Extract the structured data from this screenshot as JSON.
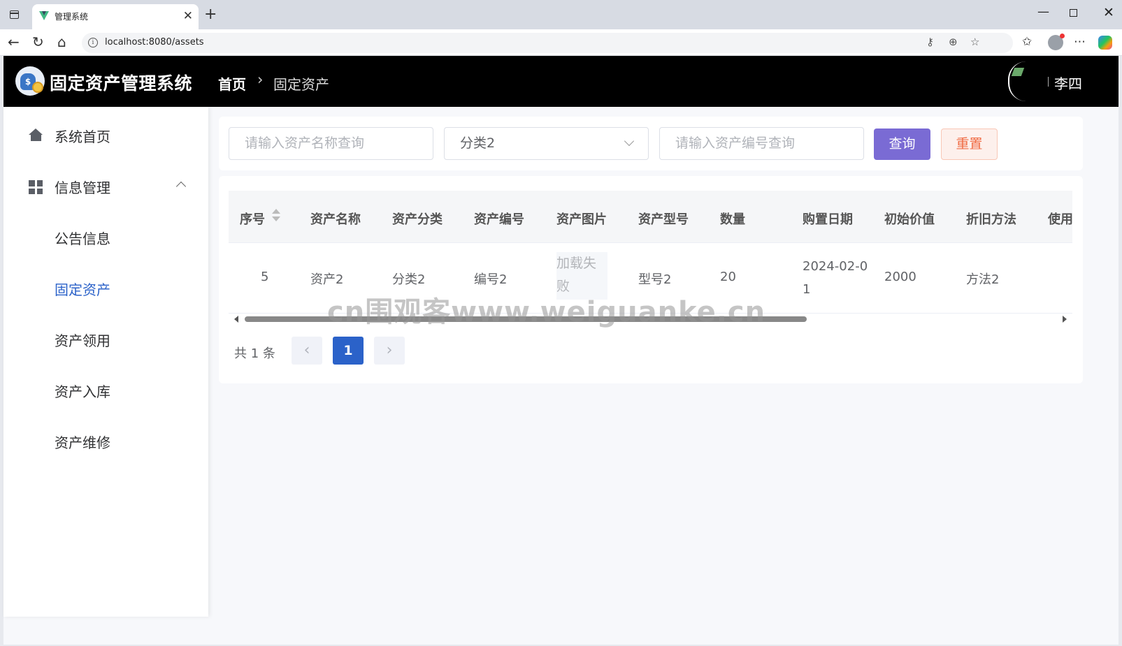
{
  "browser": {
    "tab_title": "管理系统",
    "url": "localhost:8080/assets"
  },
  "app": {
    "title": "固定资产管理系统",
    "breadcrumb": {
      "home": "首页",
      "current": "固定资产"
    },
    "user_name": "李四"
  },
  "sidebar": {
    "home": "系统首页",
    "info_group": "信息管理",
    "sub_items": [
      "公告信息",
      "固定资产",
      "资产领用",
      "资产入库",
      "资产维修"
    ],
    "active_item": "固定资产"
  },
  "search": {
    "name_placeholder": "请输入资产名称查询",
    "category_value": "分类2",
    "number_placeholder": "请输入资产编号查询",
    "query_label": "查询",
    "reset_label": "重置"
  },
  "table": {
    "columns": [
      "序号",
      "资产名称",
      "资产分类",
      "资产编号",
      "资产图片",
      "资产型号",
      "数量",
      "购置日期",
      "初始价值",
      "折旧方法",
      "使用"
    ],
    "rows": [
      {
        "index": "5",
        "name": "资产2",
        "category": "分类2",
        "number": "编号2",
        "image": "加载失败",
        "model": "型号2",
        "quantity": "20",
        "purchase_date": "2024-02-01",
        "initial_value": "2000",
        "depreciation": "方法2"
      }
    ]
  },
  "pagination": {
    "total_text": "共 1 条",
    "current_page": "1"
  },
  "watermark": "cn围观客www.weiguanke.cn",
  "colors": {
    "header_bg": "#000000",
    "primary": "#2b62c9",
    "query_button": "#7a6bd4",
    "reset_text": "#f06a42"
  }
}
